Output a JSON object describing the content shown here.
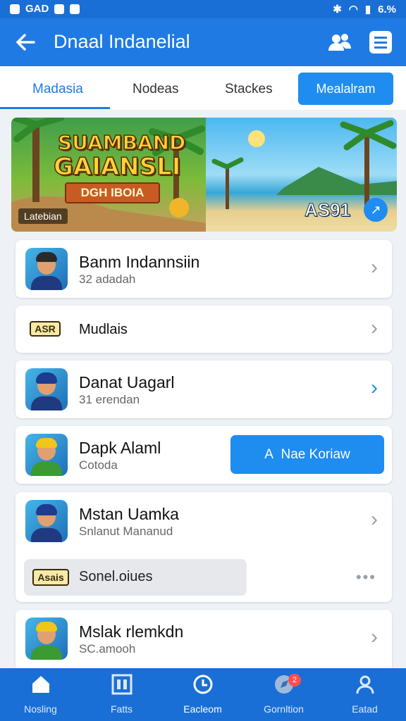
{
  "status_bar": {
    "left_text": "GAD",
    "battery": "6.%"
  },
  "app_bar": {
    "title": "Dnaal Indanelial",
    "back_icon": "arrow-left-icon",
    "people_icon": "people-icon",
    "menu_icon": "list-menu-icon"
  },
  "tabs": [
    {
      "label": "Madasia",
      "active": true
    },
    {
      "label": "Nodeas",
      "active": false
    },
    {
      "label": "Stackes",
      "active": false
    }
  ],
  "tab_button": {
    "label": "Mealalram"
  },
  "banner": {
    "title_line1": "SUAMBAND",
    "title_line2": "GAIANSLI",
    "subtitle": "DGH IBOIA",
    "badge": "Latebian",
    "score": "AS91",
    "share_icon": "share-icon"
  },
  "list": [
    {
      "name": "Banm Indannsiin",
      "sub": "32 adadah",
      "chevron": "gray"
    },
    {
      "name": "Mudlais",
      "logo": "ASR",
      "chevron": "gray"
    },
    {
      "name": "Danat Uagarl",
      "sub": "31 erendan",
      "chevron": "blue"
    },
    {
      "name": "Dapk Alaml",
      "sub": "Cotoda",
      "button": "Nae Koriaw",
      "button_prefix": "A"
    },
    {
      "name": "Mstan Uamka",
      "sub": "Snlanut Mananud",
      "chevron": "gray",
      "pill_logo": "Asais",
      "pill_text": "Sonel.oiues"
    },
    {
      "name": "Mslak rlemkdn",
      "sub": "SC.amooh",
      "chevron": "gray"
    }
  ],
  "bottom_nav": [
    {
      "label": "Nosling",
      "icon": "home-icon"
    },
    {
      "label": "Fatts",
      "icon": "grid-icon"
    },
    {
      "label": "Eacleom",
      "icon": "clock-icon",
      "active": true
    },
    {
      "label": "Gornltion",
      "icon": "compass-icon",
      "badge": "2"
    },
    {
      "label": "Eatad",
      "icon": "user-icon"
    }
  ]
}
